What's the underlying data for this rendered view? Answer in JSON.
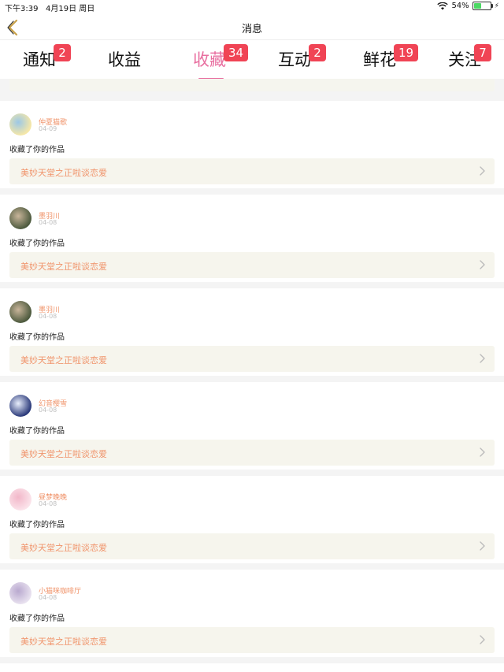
{
  "status_bar": {
    "time": "下午3:39",
    "date": "4月19日 周日",
    "battery_text": "54%",
    "battery_level": 0.54
  },
  "nav": {
    "title": "消息"
  },
  "tabs": [
    {
      "label": "通知",
      "badge": "2",
      "active": false
    },
    {
      "label": "收益",
      "badge": "",
      "active": false
    },
    {
      "label": "收藏",
      "badge": "34",
      "active": true
    },
    {
      "label": "互动",
      "badge": "2",
      "active": false
    },
    {
      "label": "鲜花",
      "badge": "19",
      "active": false
    },
    {
      "label": "关注",
      "badge": "7",
      "active": false
    }
  ],
  "colors": {
    "accent_pink": "#e86fa0",
    "badge_red": "#f04455",
    "username_orange": "#f0946b"
  },
  "feed": [
    {
      "username": "仲夏猫歌",
      "date": "04-09",
      "action": "收藏了你的作品",
      "work_title": "美妙天堂之正啦谈恋爱"
    },
    {
      "username": "墨羽川",
      "date": "04-08",
      "action": "收藏了你的作品",
      "work_title": "美妙天堂之正啦谈恋爱"
    },
    {
      "username": "墨羽川",
      "date": "04-08",
      "action": "收藏了你的作品",
      "work_title": "美妙天堂之正啦谈恋爱"
    },
    {
      "username": "幻音樱雪",
      "date": "04-08",
      "action": "收藏了你的作品",
      "work_title": "美妙天堂之正啦谈恋爱"
    },
    {
      "username": "昼梦晚晚",
      "date": "04-08",
      "action": "收藏了你的作品",
      "work_title": "美妙天堂之正啦谈恋爱"
    },
    {
      "username": "小猫咪咖啡厅",
      "date": "04-08",
      "action": "收藏了你的作品",
      "work_title": "美妙天堂之正啦谈恋爱"
    }
  ]
}
